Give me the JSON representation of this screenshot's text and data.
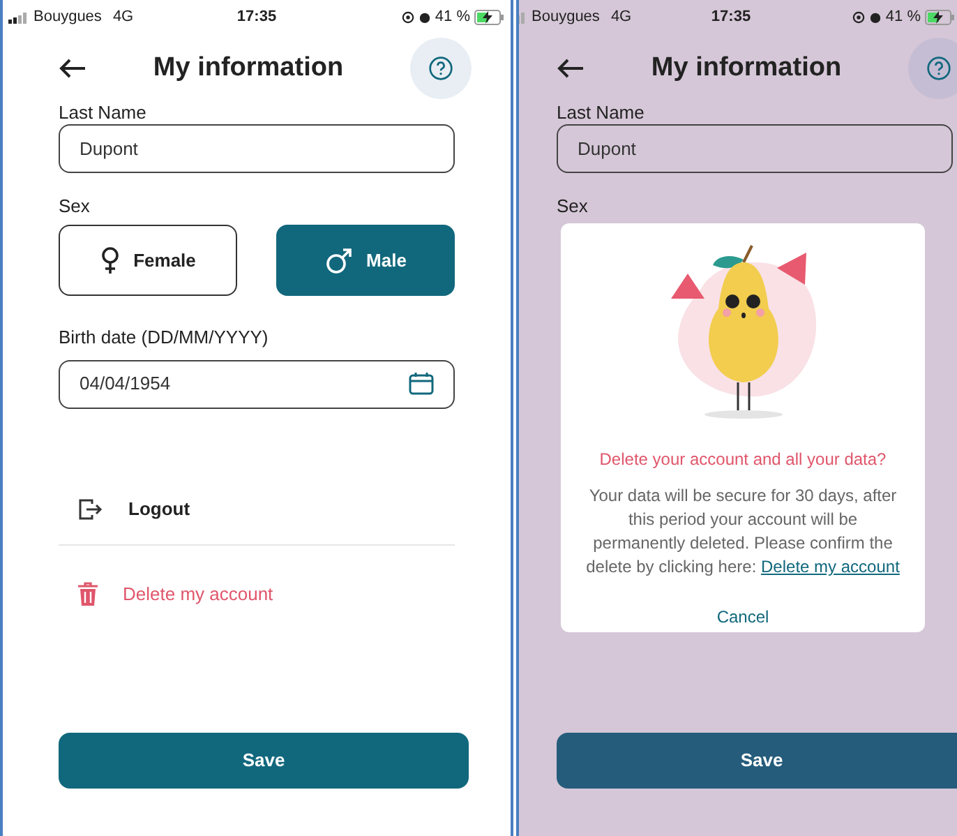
{
  "screens": [
    {
      "status_bar": {
        "carrier": "Bouygues",
        "network": "4G",
        "time": "17:35",
        "battery": "41 %"
      },
      "header": {
        "title": "My information"
      },
      "last_name": {
        "label": "Last Name",
        "value": "Dupont"
      },
      "sex": {
        "label": "Sex",
        "options": [
          {
            "kind": "female",
            "label": "Female",
            "selected": false
          },
          {
            "kind": "male",
            "label": "Male",
            "selected": true
          }
        ]
      },
      "birth_date": {
        "label": "Birth date (DD/MM/YYYY)",
        "value": "04/04/1954"
      },
      "actions": [
        {
          "kind": "logout",
          "label": "Logout"
        },
        {
          "kind": "delete",
          "label": "Delete my account"
        }
      ],
      "save_button": "Save"
    },
    {
      "status_bar": {
        "carrier": "Bouygues",
        "network": "4G",
        "time": "17:35",
        "battery": "41 %"
      },
      "header": {
        "title": "My information"
      },
      "last_name": {
        "label": "Last Name",
        "value": "Dupont"
      },
      "sex": {
        "label": "Sex"
      },
      "save_button": "Save",
      "dialog": {
        "title": "Delete your account and all your data?",
        "message": "Your data will be secure for 30 days, after this period your account will be permanently deleted. Please confirm the delete by clicking here:",
        "link": "Delete my account",
        "cancel": "Cancel"
      }
    }
  ]
}
